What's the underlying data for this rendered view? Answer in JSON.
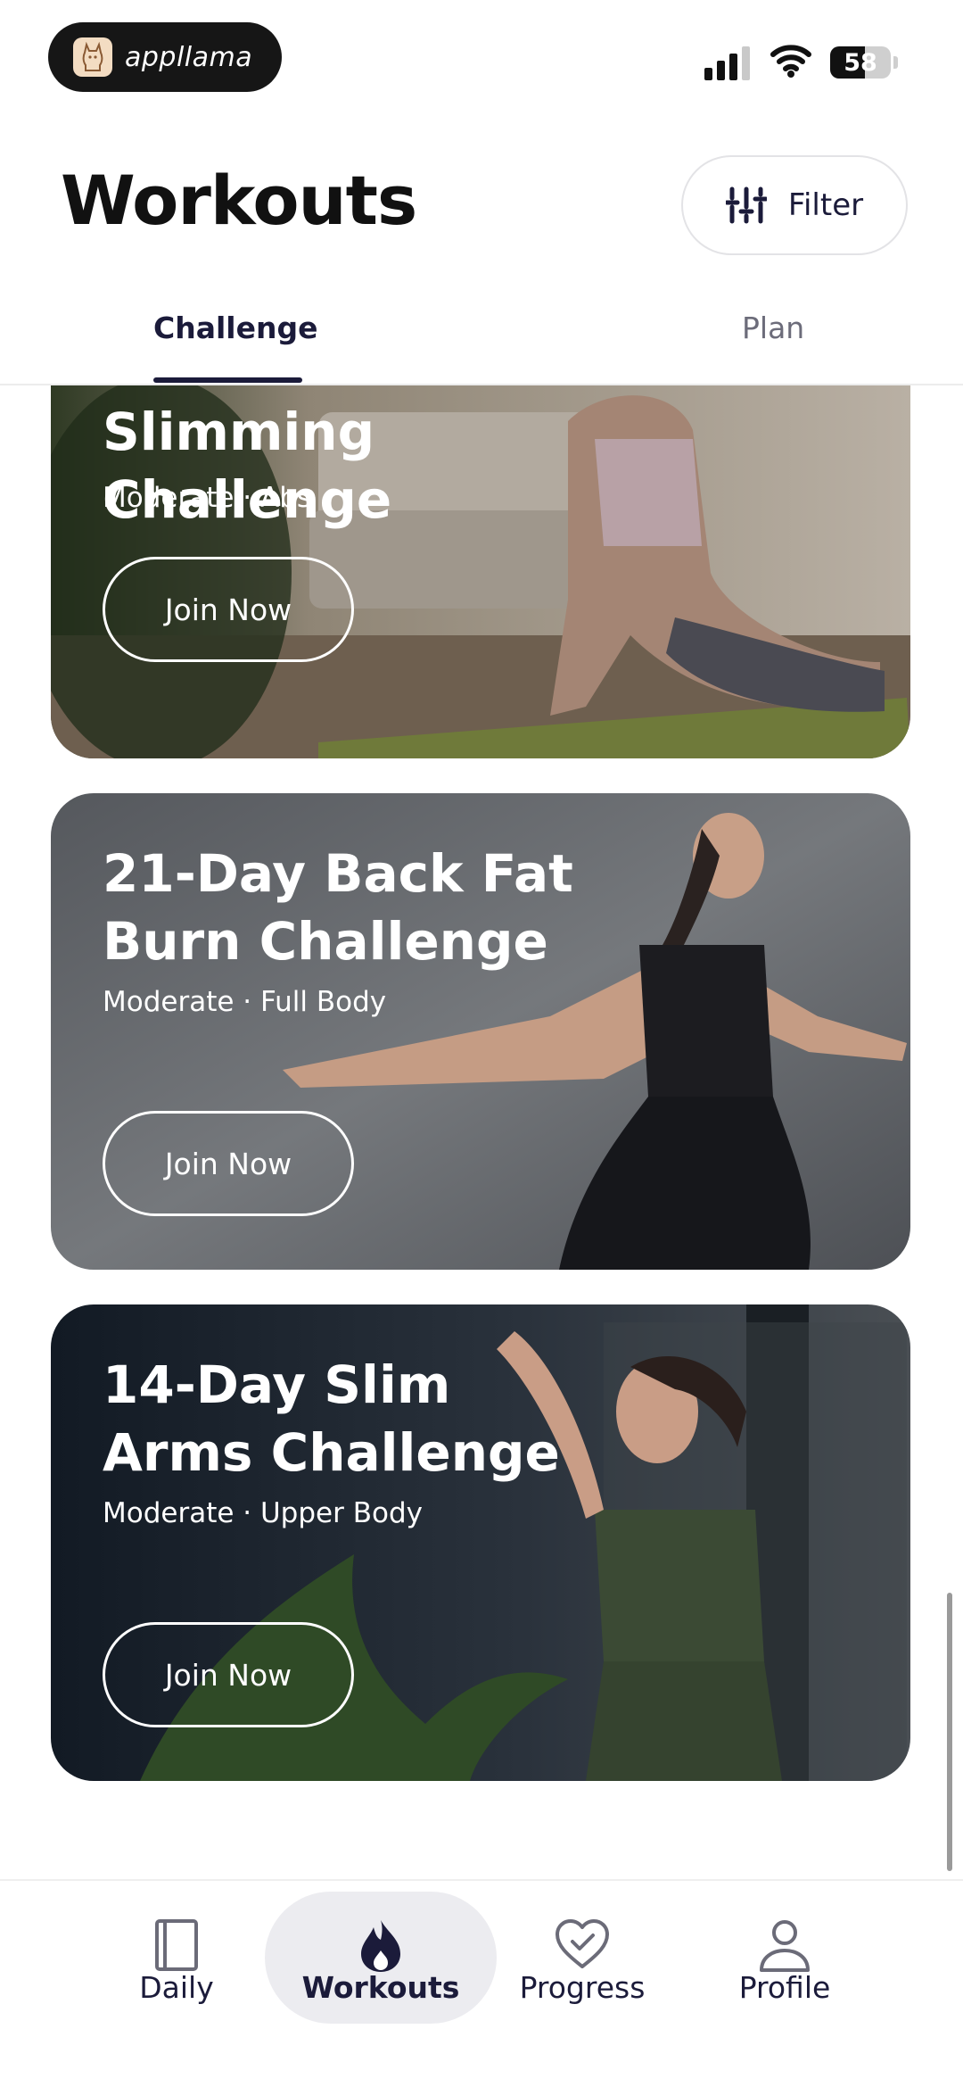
{
  "status_bar": {
    "app_name": "appllama",
    "battery_level": "58"
  },
  "header": {
    "title": "Workouts",
    "filter_label": "Filter"
  },
  "tabs": [
    {
      "label": "Challenge",
      "active": true
    },
    {
      "label": "Plan",
      "active": false
    }
  ],
  "cards": [
    {
      "title": "Slimming Challenge",
      "meta": "Moderate · Abs",
      "button": "Join Now"
    },
    {
      "title": "21-Day Back Fat Burn Challenge",
      "meta": "Moderate · Full Body",
      "button": "Join Now"
    },
    {
      "title": "14-Day Slim Arms Challenge",
      "meta": "Moderate · Upper Body",
      "button": "Join Now"
    }
  ],
  "bottom_nav": [
    {
      "label": "Daily",
      "icon": "book-icon",
      "active": false
    },
    {
      "label": "Workouts",
      "icon": "flame-icon",
      "active": true
    },
    {
      "label": "Progress",
      "icon": "heart-check-icon",
      "active": false
    },
    {
      "label": "Profile",
      "icon": "person-icon",
      "active": false
    }
  ],
  "colors": {
    "accent": "#1b1b3a",
    "card1_bg": "#8a7d6c",
    "card2_bg": "#5f6266",
    "card3_bg": "#1d2630"
  }
}
